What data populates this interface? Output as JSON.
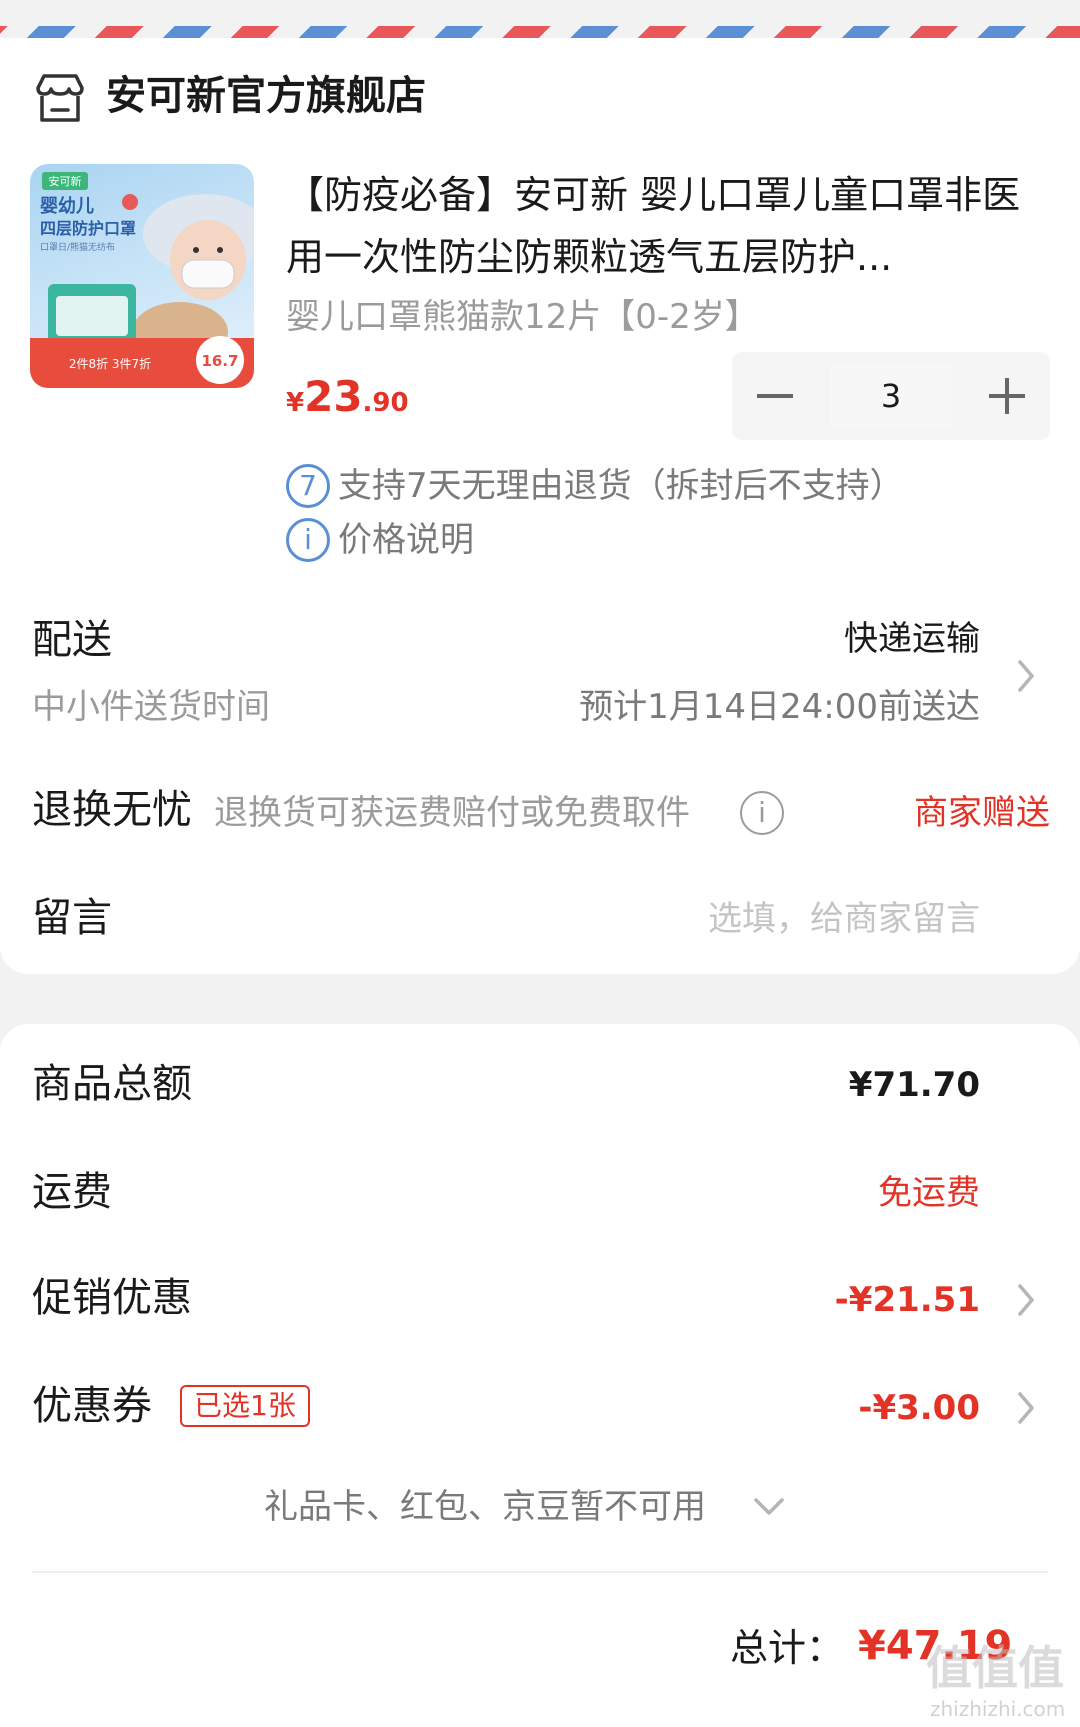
{
  "store": {
    "name": "安可新官方旗舰店",
    "icon": "store-icon"
  },
  "product": {
    "title": "【防疫必备】安可新 婴儿口罩儿童口罩非医用一次性防尘防颗粒透气五层防护...",
    "variant": "婴儿口罩熊猫款12片【0-2岁】",
    "price_currency": "¥",
    "price_int": "23",
    "price_dec": ".90",
    "quantity": "3",
    "image_text": {
      "brand": "安可新",
      "line1": "婴幼儿",
      "line2": "四层防护口罩",
      "line3": "口罩日/熊猫无纺布",
      "promo": "2件8折 3件7折",
      "badge": "16.7"
    }
  },
  "services": {
    "return_badge": "7",
    "return_text": "支持7天无理由退货（拆封后不支持）",
    "price_info_icon": "i",
    "price_info_text": "价格说明"
  },
  "delivery": {
    "label": "配送",
    "method": "快递运输",
    "time_label": "中小件送货时间",
    "eta": "预计1月14日24:00前送达"
  },
  "returns": {
    "label": "退换无忧",
    "desc": "退换货可获运费赔付或免费取件",
    "info_icon": "i",
    "badge": "商家赠送"
  },
  "message": {
    "label": "留言",
    "placeholder": "选填，给商家留言"
  },
  "summary": {
    "goods_label": "商品总额",
    "goods_value": "¥71.70",
    "shipping_label": "运费",
    "shipping_value": "免运费",
    "promo_label": "促销优惠",
    "promo_value": "-¥21.51",
    "coupon_label": "优惠券",
    "coupon_tag": "已选1张",
    "coupon_value": "-¥3.00",
    "unavailable": "礼品卡、红包、京豆暂不可用",
    "total_label": "总计：",
    "total_value": "¥47.19"
  },
  "watermark": {
    "cn": "值值值",
    "en": "zhizhizhi.com"
  },
  "colors": {
    "accent_red": "#e33327",
    "link_blue": "#5a8fd6",
    "gray_text": "#9b9b9b"
  }
}
